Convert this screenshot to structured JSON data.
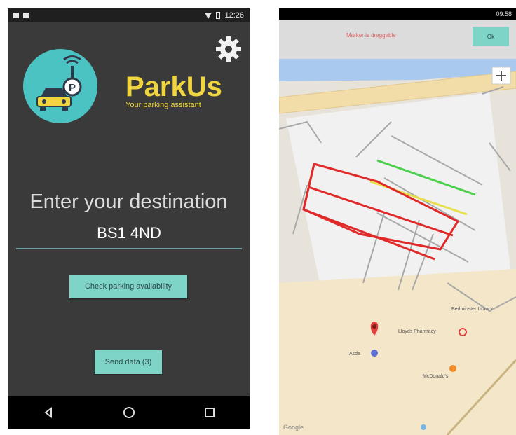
{
  "left_screen": {
    "status": {
      "time": "12:26"
    },
    "brand": {
      "title": "ParkUs",
      "subtitle": "Your parking assistant"
    },
    "destination": {
      "label": "Enter your destination",
      "value": "BS1 4ND"
    },
    "buttons": {
      "check": "Check parking availability",
      "send": "Send data (3)"
    },
    "icons": [
      "settings-gear-icon",
      "parking-logo-icon",
      "nav-back-icon",
      "nav-home-icon",
      "nav-recents-icon"
    ]
  },
  "right_screen": {
    "status": {
      "time": "09:58"
    },
    "map_header": {
      "hint": "Marker is draggable",
      "ok_label": "Ok"
    },
    "places": {
      "library": "Bedminster Library",
      "pharmacy": "Lloyds Pharmacy",
      "store": "Asda",
      "food": "McDonald's"
    },
    "map_attribution": "Google",
    "colors": {
      "available": "#4cd04c",
      "limited": "#e6e04a",
      "full": "#e02a2a"
    }
  }
}
